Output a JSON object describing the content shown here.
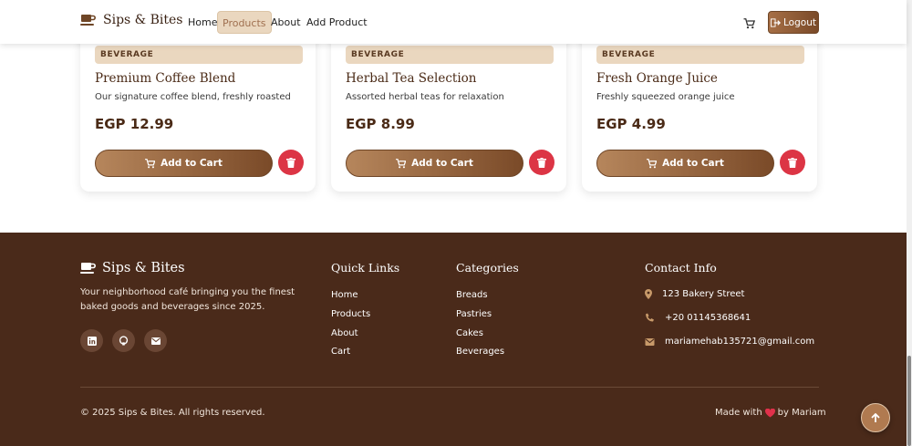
{
  "nav": {
    "brand": "Sips & Bites",
    "links": [
      {
        "label": "Home"
      },
      {
        "label": "Products",
        "active": true
      },
      {
        "label": "About"
      },
      {
        "label": "Add Product"
      }
    ],
    "cart_icon": "shopping-cart-icon",
    "logout_label": "Logout"
  },
  "products": [
    {
      "category": "BEVERAGE",
      "name": "Premium Coffee Blend",
      "description": "Our signature coffee blend, freshly roasted",
      "price": "EGP 12.99",
      "add_label": "Add to Cart"
    },
    {
      "category": "BEVERAGE",
      "name": "Herbal Tea Selection",
      "description": "Assorted herbal teas for relaxation",
      "price": "EGP 8.99",
      "add_label": "Add to Cart"
    },
    {
      "category": "BEVERAGE",
      "name": "Fresh Orange Juice",
      "description": "Freshly squeezed orange juice",
      "price": "EGP 4.99",
      "add_label": "Add to Cart"
    }
  ],
  "footer": {
    "brand": "Sips & Bites",
    "tagline": "Your neighborhood café bringing you the finest baked goods and beverages since 2025.",
    "social": [
      "linkedin-icon",
      "github-icon",
      "envelope-icon"
    ],
    "quick_links": {
      "title": "Quick Links",
      "items": [
        "Home",
        "Products",
        "About",
        "Cart"
      ]
    },
    "categories": {
      "title": "Categories",
      "items": [
        "Breads",
        "Pastries",
        "Cakes",
        "Beverages"
      ]
    },
    "contact": {
      "title": "Contact Info",
      "address": "123 Bakery Street",
      "phone": "+20 01145368641",
      "email": "mariamehab135721@gmail.com"
    },
    "copyright": "© 2025 Sips & Bites. All rights reserved.",
    "made_with_prefix": "Made with",
    "made_with_suffix": "by Mariam"
  },
  "colors": {
    "brand_brown": "#4a2a1a",
    "accent_tan": "#b6865c",
    "delete_red": "#dc3545",
    "badge_beige": "#ead7bf"
  }
}
